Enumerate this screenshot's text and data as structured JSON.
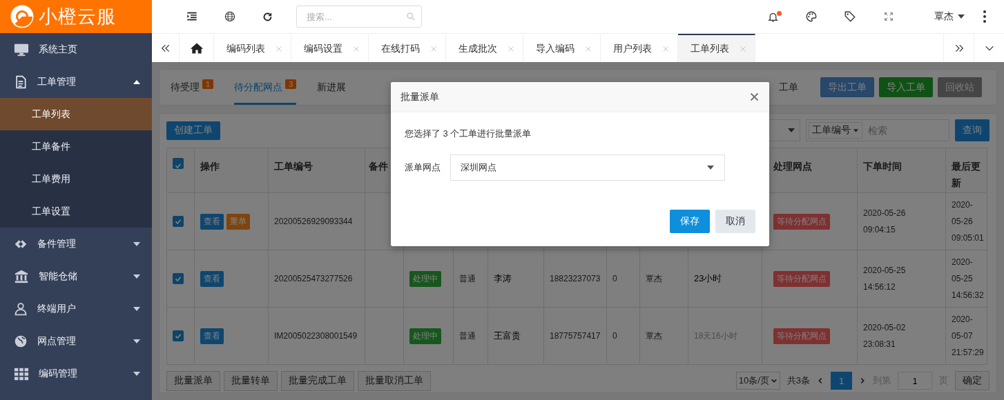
{
  "brand": {
    "name": "小橙云服"
  },
  "sidebar": {
    "items": [
      {
        "label": "系统主页"
      },
      {
        "label": "工单管理",
        "expanded": true,
        "children": [
          {
            "label": "工单列表",
            "selected": true
          },
          {
            "label": "工单备件",
            "selected": false
          },
          {
            "label": "工单费用",
            "selected": false
          },
          {
            "label": "工单设置",
            "selected": false
          }
        ]
      },
      {
        "label": "备件管理",
        "expanded": false
      },
      {
        "label": "智能仓储",
        "expanded": false
      },
      {
        "label": "终端用户",
        "expanded": false
      },
      {
        "label": "网点管理",
        "expanded": false
      },
      {
        "label": "编码管理",
        "expanded": false
      }
    ]
  },
  "topbar": {
    "search": {
      "placeholder": "搜索..."
    },
    "notifications": {
      "unread": true
    },
    "user": {
      "name": "覃杰"
    }
  },
  "page_tabs": {
    "items": [
      {
        "label": "编码列表",
        "selected": false
      },
      {
        "label": "编码设置",
        "selected": false
      },
      {
        "label": "在线打码",
        "selected": false
      },
      {
        "label": "生成批次",
        "selected": false
      },
      {
        "label": "导入编码",
        "selected": false
      },
      {
        "label": "用户列表",
        "selected": false
      },
      {
        "label": "工单列表",
        "selected": true
      }
    ]
  },
  "status_tabs": {
    "items": [
      {
        "label": "待受理",
        "count": "1",
        "selected": false
      },
      {
        "label": "待分配网点",
        "count": "3",
        "selected": true
      },
      {
        "label": "新进展",
        "selected": false
      }
    ],
    "obscured_tab_label": "工单"
  },
  "toolbar_buttons": [
    {
      "label": "导出工单",
      "kind": "export"
    },
    {
      "label": "导入工单",
      "kind": "import"
    },
    {
      "label": "回收站",
      "kind": "recycle"
    }
  ],
  "create_button": "创建工单",
  "filters": {
    "search_field": {
      "label": "工单编号",
      "placeholder": "检索"
    },
    "query_button": "查询"
  },
  "table": {
    "all_selected": true,
    "columns": {
      "actions": "操作",
      "order_no": "工单编号",
      "parts": "备件",
      "network": "处理网点",
      "order_time": "下单时间",
      "updated": "最后更新"
    },
    "rows": [
      {
        "checked": true,
        "actions": [
          {
            "label": "查看",
            "kind": "view"
          },
          {
            "label": "重单",
            "kind": "duplicate"
          }
        ],
        "order_no": "20200526929093344",
        "network_status": "等待分配网点",
        "order_time": "2020-05-26 09:04:15",
        "updated": "2020-05-26 09:05:01"
      },
      {
        "checked": true,
        "actions": [
          {
            "label": "查看",
            "kind": "view"
          }
        ],
        "order_no": "20200525473277526",
        "status": "处理中",
        "priority": "普通",
        "customer": "李涛",
        "phone": "18823237073",
        "count": "0",
        "handler": "覃杰",
        "elapsed": "23小时",
        "overdue": false,
        "network_status": "等待分配网点",
        "order_time": "2020-05-25 14:56:12",
        "updated": "2020-05-25 14:56:32"
      },
      {
        "checked": true,
        "actions": [
          {
            "label": "查看",
            "kind": "view"
          }
        ],
        "order_no": "IM2005022308001549",
        "status": "处理中",
        "priority": "普通",
        "customer": "王富贵",
        "phone": "18775757417",
        "count": "0",
        "handler": "覃杰",
        "elapsed": "18天16小时",
        "overdue": true,
        "network_status": "等待分配网点",
        "order_time": "2020-05-02 23:08:31",
        "updated": "2020-05-07 21:57:29"
      }
    ]
  },
  "batch_actions": [
    "批量派单",
    "批量转单",
    "批量完成工单",
    "批量取消工单"
  ],
  "pagination": {
    "page_size": "10条/页",
    "total": "共3条",
    "pages": [
      {
        "label": "1",
        "selected": true
      }
    ],
    "goto_label": "到第",
    "goto_value": "1",
    "page_label": "页",
    "confirm": "确定"
  },
  "dialog": {
    "title": "批量派单",
    "message": "您选择了 3 个工单进行批量派单",
    "field_label": "派单网点",
    "field_value": "深圳网点",
    "buttons": [
      {
        "label": "保存",
        "kind": "primary"
      },
      {
        "label": "取消",
        "kind": "secondary"
      }
    ]
  }
}
